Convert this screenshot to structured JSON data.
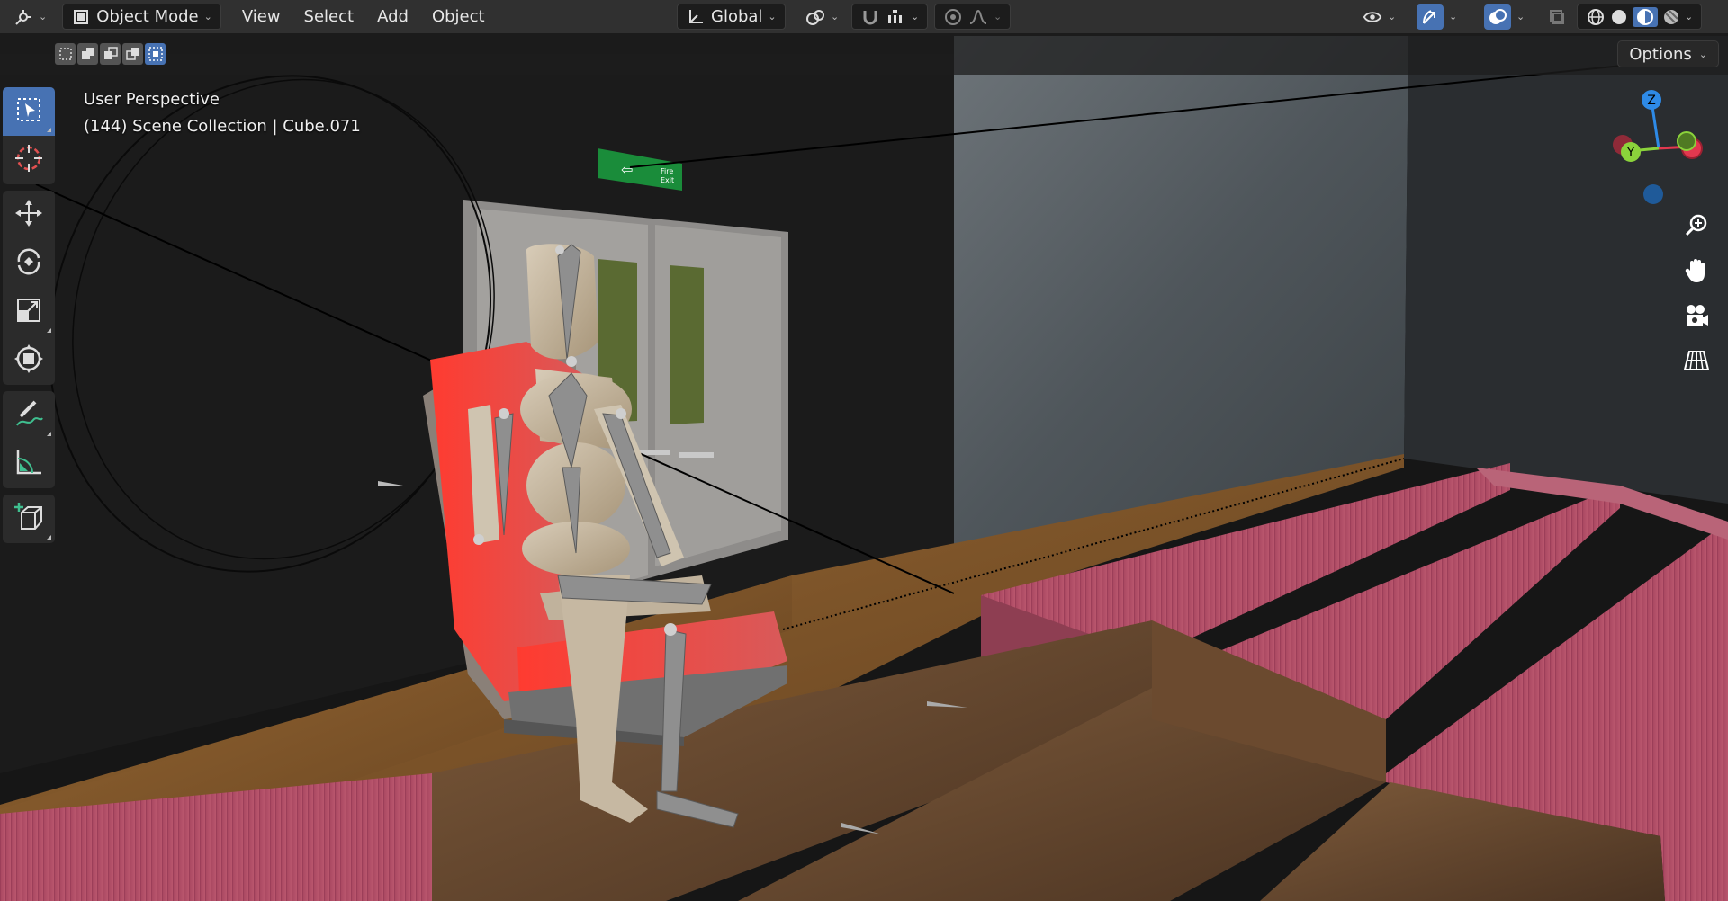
{
  "header": {
    "mode_label": "Object Mode",
    "menus": [
      "View",
      "Select",
      "Add",
      "Object"
    ],
    "transform_orientation": "Global"
  },
  "subbar": {
    "options_label": "Options"
  },
  "viewport": {
    "perspective_label": "User Perspective",
    "collection_label": "(144) Scene Collection | Cube.071",
    "exit_sign": {
      "line1": "Fire",
      "line2": "Exit"
    }
  },
  "gizmo": {
    "z_label": "Z",
    "y_label": "Y"
  },
  "colors": {
    "header_bg": "#303030",
    "accent": "#4772b3",
    "axis_x": "#e2384f",
    "axis_y": "#8bd33b",
    "axis_z": "#2e8ae6"
  },
  "icons": {
    "editor_type": "view3d-icon",
    "tools": [
      "select-box-icon",
      "cursor-icon",
      "move-icon",
      "rotate-icon",
      "scale-icon",
      "transform-icon",
      "annotate-icon",
      "measure-icon",
      "add-cube-icon"
    ],
    "nav": [
      "zoom-icon",
      "pan-hand-icon",
      "camera-icon",
      "grid-view-icon"
    ]
  }
}
